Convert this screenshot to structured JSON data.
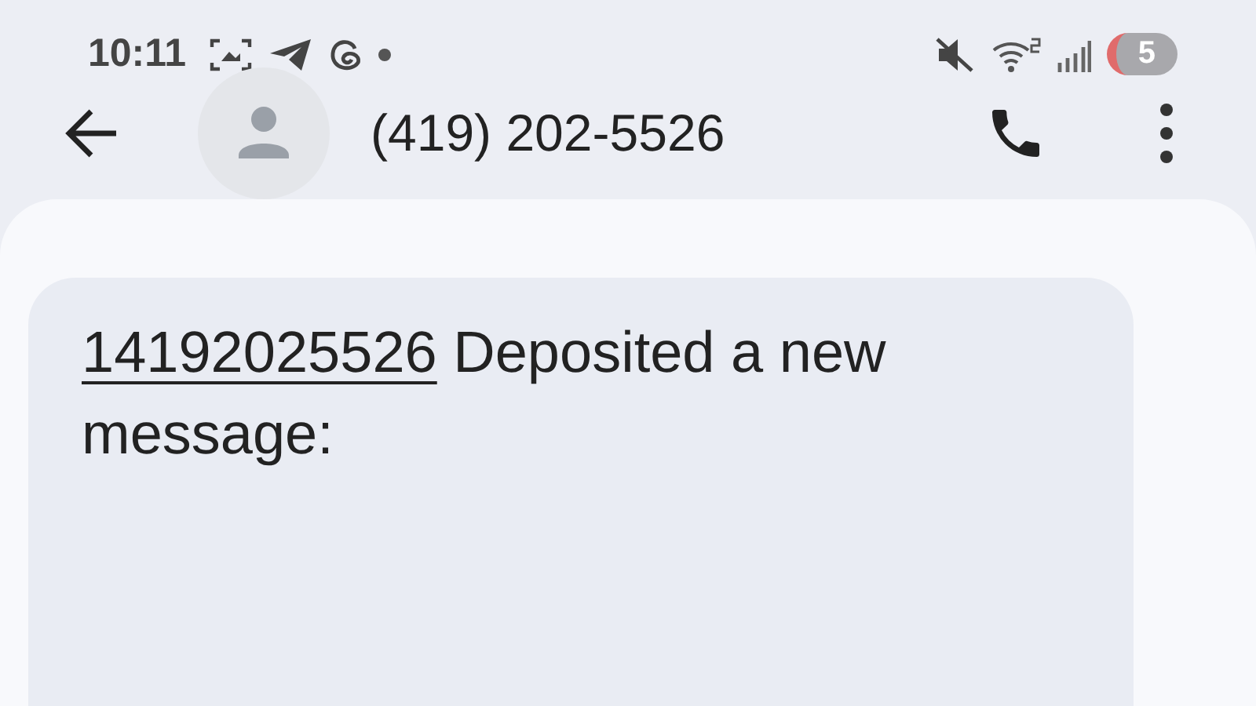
{
  "status_bar": {
    "time": "10:11",
    "battery": "5"
  },
  "header": {
    "contact": "(419) 202-5526"
  },
  "message": {
    "link": "14192025526",
    "text": " Deposited a new message:"
  }
}
